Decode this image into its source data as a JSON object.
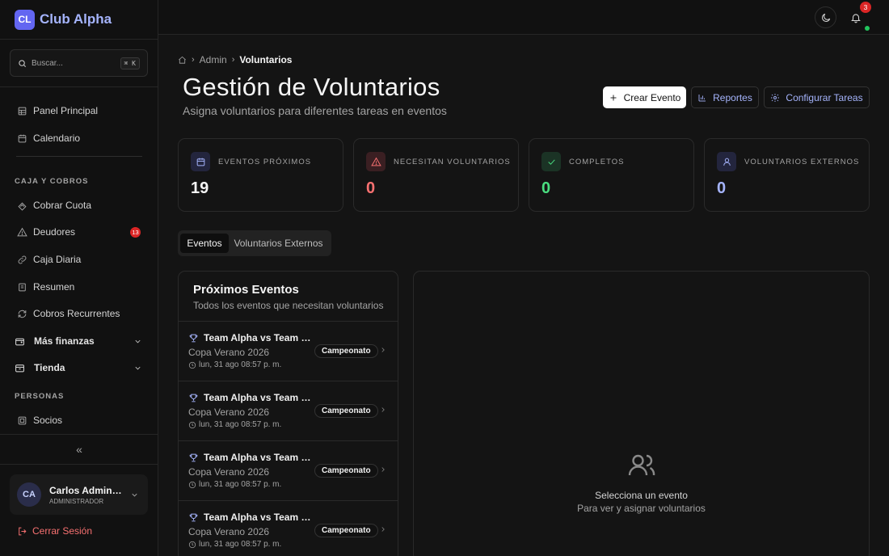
{
  "brand": {
    "logo_text": "CL",
    "name": "Club Alpha"
  },
  "search": {
    "placeholder": "Buscar...",
    "shortcut": "⌘ K"
  },
  "sidebar": {
    "items": [
      {
        "label": "Panel Principal",
        "icon": "layout-grid-icon"
      },
      {
        "label": "Calendario",
        "icon": "calendar-icon"
      }
    ],
    "section_caja": "CAJA Y COBROS",
    "caja_items": [
      {
        "label": "Cobrar Cuota",
        "icon": "banknote-icon"
      },
      {
        "label": "Deudores",
        "icon": "alert-triangle-icon",
        "badge": "13"
      },
      {
        "label": "Caja Diaria",
        "icon": "wallet-icon"
      },
      {
        "label": "Resumen",
        "icon": "receipt-icon"
      },
      {
        "label": "Cobros Recurrentes",
        "icon": "repeat-icon"
      }
    ],
    "groups": [
      {
        "label": "Más finanzas",
        "icon": "wallet-icon"
      },
      {
        "label": "Tienda",
        "icon": "store-icon"
      }
    ],
    "section_personas": "PERSONAS",
    "personas_items": [
      {
        "label": "Socios",
        "icon": "id-card-icon"
      }
    ],
    "collapse_glyph": "«"
  },
  "user": {
    "initials": "CA",
    "name": "Carlos Administrador",
    "role": "ADMINISTRADOR"
  },
  "logout_label": "Cerrar Sesión",
  "topbar": {
    "notifications_count": "3"
  },
  "breadcrumb": {
    "parent": "Admin",
    "current": "Voluntarios"
  },
  "page": {
    "title": "Gestión de Voluntarios",
    "subtitle": "Asigna voluntarios para diferentes tareas en eventos"
  },
  "actions": {
    "create": "Crear Evento",
    "reports": "Reportes",
    "configure": "Configurar Tareas"
  },
  "stats": [
    {
      "label": "EVENTOS PRÓXIMOS",
      "value": "19",
      "color": "#f5f5f5",
      "icon": "calendar-icon"
    },
    {
      "label": "NECESITAN VOLUNTARIOS",
      "value": "0",
      "color": "#f87171",
      "icon": "alert-triangle-icon"
    },
    {
      "label": "COMPLETOS",
      "value": "0",
      "color": "#4ade80",
      "icon": "check-icon"
    },
    {
      "label": "VOLUNTARIOS EXTERNOS",
      "value": "0",
      "color": "#a5b4fc",
      "icon": "user-icon"
    }
  ],
  "tabs": [
    {
      "label": "Eventos",
      "active": true
    },
    {
      "label": "Voluntarios Externos",
      "active": false
    }
  ],
  "events_panel": {
    "title": "Próximos Eventos",
    "subtitle": "Todos los eventos que necesitan voluntarios",
    "events": [
      {
        "title": "Team Alpha vs Team Bravo",
        "tournament": "Copa Verano 2026",
        "date": "lun, 31 ago 08:57 p. m.",
        "badge": "Campeonato"
      },
      {
        "title": "Team Alpha vs Team Bravo",
        "tournament": "Copa Verano 2026",
        "date": "lun, 31 ago 08:57 p. m.",
        "badge": "Campeonato"
      },
      {
        "title": "Team Alpha vs Team Bravo",
        "tournament": "Copa Verano 2026",
        "date": "lun, 31 ago 08:57 p. m.",
        "badge": "Campeonato"
      },
      {
        "title": "Team Alpha vs Team Bravo",
        "tournament": "Copa Verano 2026",
        "date": "lun, 31 ago 08:57 p. m.",
        "badge": "Campeonato"
      }
    ]
  },
  "detail_panel": {
    "empty_title": "Selecciona un evento",
    "empty_subtitle": "Para ver y asignar voluntarios"
  }
}
